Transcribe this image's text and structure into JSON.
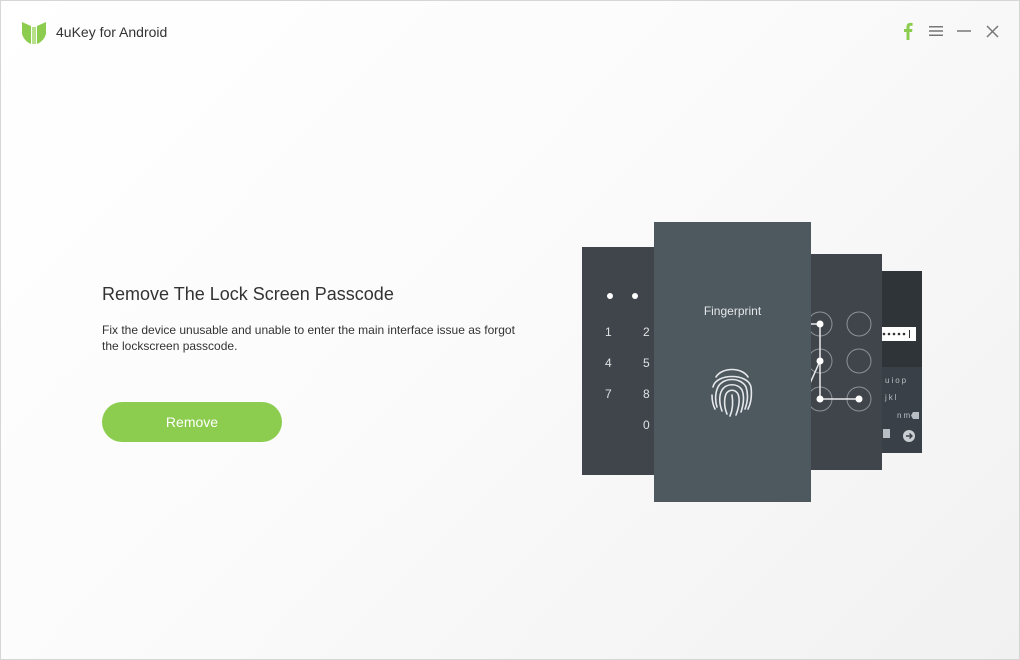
{
  "app": {
    "title": "4uKey for Android",
    "logo_icon": "tenorshare-logo",
    "accent_color": "#8ccd4f"
  },
  "window_controls": {
    "facebook_icon": "facebook-icon",
    "menu_icon": "menu-icon",
    "minimize_icon": "minimize-icon",
    "close_icon": "close-icon"
  },
  "main": {
    "heading": "Remove The Lock Screen Passcode",
    "description": "Fix the device unusable and unable to enter the main interface issue as forgot the lockscreen passcode.",
    "remove_button": "Remove"
  },
  "illustration": {
    "fingerprint_label": "Fingerprint",
    "pin_digits": [
      "1",
      "2",
      "4",
      "5",
      "7",
      "8",
      "0"
    ],
    "keyboard_rows": [
      "uiop",
      "jkl",
      "nm"
    ]
  }
}
